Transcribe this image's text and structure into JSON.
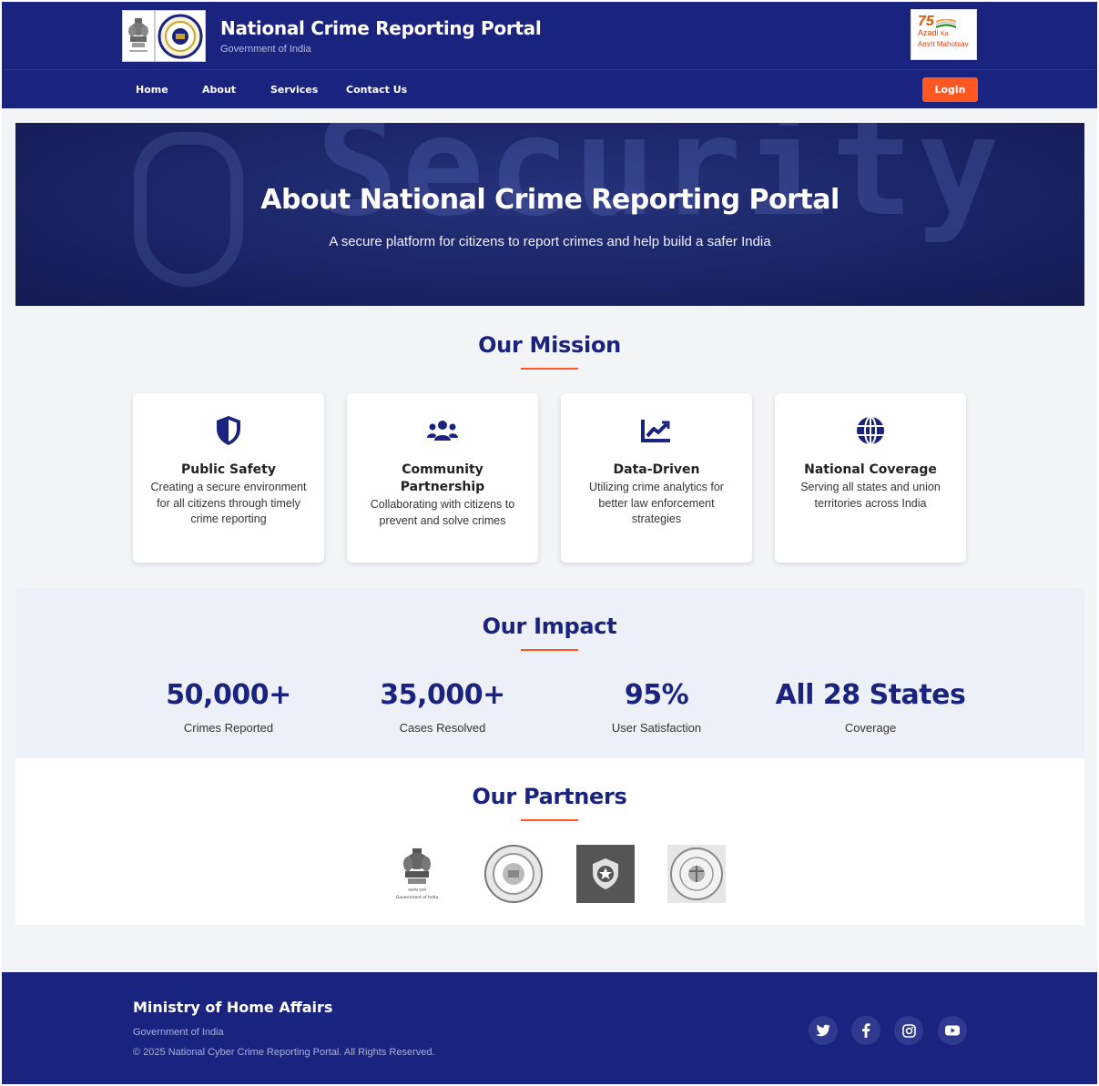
{
  "header": {
    "title": "National Crime Reporting Portal",
    "subtitle": "Government of India",
    "azadi_logo_text": [
      "75",
      "Azadi",
      "Ka",
      "Amrit Mahotsav"
    ]
  },
  "nav": {
    "items": [
      {
        "label": "Home"
      },
      {
        "label": "About"
      },
      {
        "label": "Services"
      },
      {
        "label": "Contact Us"
      }
    ],
    "login_label": "Login"
  },
  "hero": {
    "title": "About National Crime Reporting Portal",
    "subtitle": "A secure platform for citizens to report crimes and help build a safer India",
    "background_word": "Security"
  },
  "mission": {
    "heading": "Our Mission",
    "cards": [
      {
        "icon": "shield-icon",
        "title": "Public Safety",
        "description": "Creating a secure environment for all citizens through timely crime reporting"
      },
      {
        "icon": "users-icon",
        "title": "Community Partnership",
        "description": "Collaborating with citizens to prevent and solve crimes"
      },
      {
        "icon": "chart-line-icon",
        "title": "Data-Driven",
        "description": "Utilizing crime analytics for better law enforcement strategies"
      },
      {
        "icon": "globe-icon",
        "title": "National Coverage",
        "description": "Serving all states and union territories across India"
      }
    ]
  },
  "impact": {
    "heading": "Our Impact",
    "stats": [
      {
        "value": "50,000+",
        "label": "Crimes Reported"
      },
      {
        "value": "35,000+",
        "label": "Cases Resolved"
      },
      {
        "value": "95%",
        "label": "User Satisfaction"
      },
      {
        "value": "All 28 States",
        "label": "Coverage"
      }
    ]
  },
  "partners": {
    "heading": "Our Partners",
    "logos": [
      {
        "name": "government-of-india-emblem",
        "caption": "Government of India"
      },
      {
        "name": "nia-seal"
      },
      {
        "name": "police-badge"
      },
      {
        "name": "cyber-cell-india-seal"
      }
    ]
  },
  "footer": {
    "title": "Ministry of Home Affairs",
    "subtitle": "Government of India",
    "copyright": "© 2025 National Cyber Crime Reporting Portal. All Rights Reserved.",
    "social": [
      "twitter-icon",
      "facebook-icon",
      "instagram-icon",
      "youtube-icon"
    ]
  },
  "colors": {
    "primary": "#1a237e",
    "accent": "#ff5722",
    "impact_bg": "#eef0f7"
  }
}
